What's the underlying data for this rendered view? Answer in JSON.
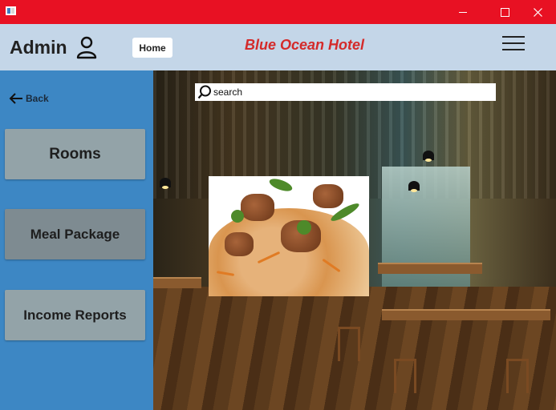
{
  "window": {
    "icon": "app-icon",
    "controls": [
      "minimize-icon",
      "maximize-icon",
      "close-icon"
    ]
  },
  "header": {
    "admin_label": "Admin",
    "user_icon": "user-icon",
    "home_button": "Home",
    "hotel_name": "Blue Ocean Hotel",
    "menu_icon": "hamburger-menu-icon",
    "title_color": "#d42a2a"
  },
  "sidebar": {
    "back_label": "Back",
    "back_icon": "arrow-left-icon",
    "items": [
      {
        "label": "Rooms"
      },
      {
        "label": "Meal Package"
      },
      {
        "label": "Income Reports"
      }
    ],
    "background": "#3d87c4"
  },
  "main": {
    "search": {
      "placeholder": "search",
      "icon": "search-icon"
    },
    "food_image": "meal-photo"
  },
  "colors": {
    "titlebar": "#e81123",
    "header": "#c4d6e8"
  }
}
